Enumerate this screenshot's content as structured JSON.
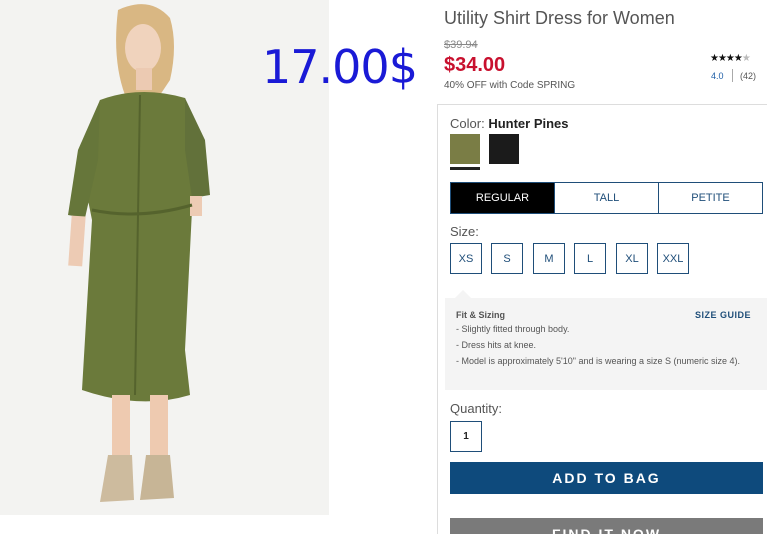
{
  "overlay_price": "17.00$",
  "product": {
    "title": "Utility Shirt Dress for Women",
    "old_price": "$39.94",
    "price": "$34.00",
    "promo": "40% OFF with Code SPRING",
    "rating": "4.0",
    "reviews": "(42)",
    "stars_filled": "★★★★",
    "stars_empty": "★"
  },
  "color": {
    "label": "Color:",
    "selected": "Hunter Pines",
    "swatches": [
      "#7a7d45",
      "#1b1b1b"
    ]
  },
  "fit_tabs": [
    "REGULAR",
    "TALL",
    "PETITE"
  ],
  "size": {
    "label": "Size:",
    "options": [
      "XS",
      "S",
      "M",
      "L",
      "XL",
      "XXL"
    ]
  },
  "fit_sizing": {
    "title": "Fit & Sizing",
    "guide_link": "SIZE GUIDE",
    "items": [
      "- Slightly fitted through body.",
      "- Dress hits at knee.",
      "- Model is approximately 5'10\" and is wearing a size S (numeric size 4)."
    ]
  },
  "quantity": {
    "label": "Quantity:",
    "value": "1"
  },
  "buttons": {
    "add_to_bag": "ADD TO BAG",
    "find_it_now": "FIND IT NOW"
  }
}
